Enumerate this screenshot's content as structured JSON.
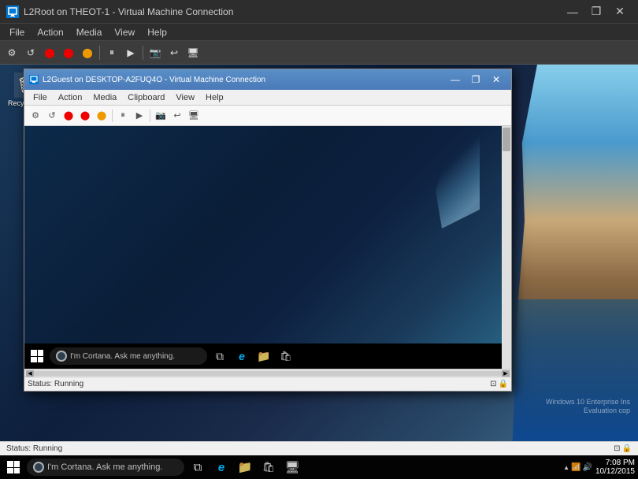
{
  "outer": {
    "title": "L2Root on THEOT-1 - Virtual Machine Connection",
    "menu": [
      "File",
      "Action",
      "Media",
      "View",
      "Help"
    ],
    "statusbar": {
      "status": "Status: Running"
    }
  },
  "inner": {
    "title": "L2Guest on DESKTOP-A2FUQ4O - Virtual Machine Connection",
    "menu": [
      "File",
      "Action",
      "Media",
      "Clipboard",
      "View",
      "Help"
    ],
    "statusbar": {
      "status": "Status: Running"
    }
  },
  "taskbars": {
    "cortana_placeholder": "I'm Cortana. Ask me anything.",
    "outer_time": "7:08 PM",
    "outer_date": "10/12/2015"
  },
  "watermark": {
    "line1": "Windows 10 Enterprise Ins",
    "line2": "Evaluation cop"
  },
  "icons": {
    "minimize": "—",
    "restore": "❐",
    "close": "✕",
    "start_win": "⊞",
    "task_view": "⧉",
    "edge": "e",
    "folder": "📁",
    "store": "🛍",
    "remote": "🖥"
  }
}
